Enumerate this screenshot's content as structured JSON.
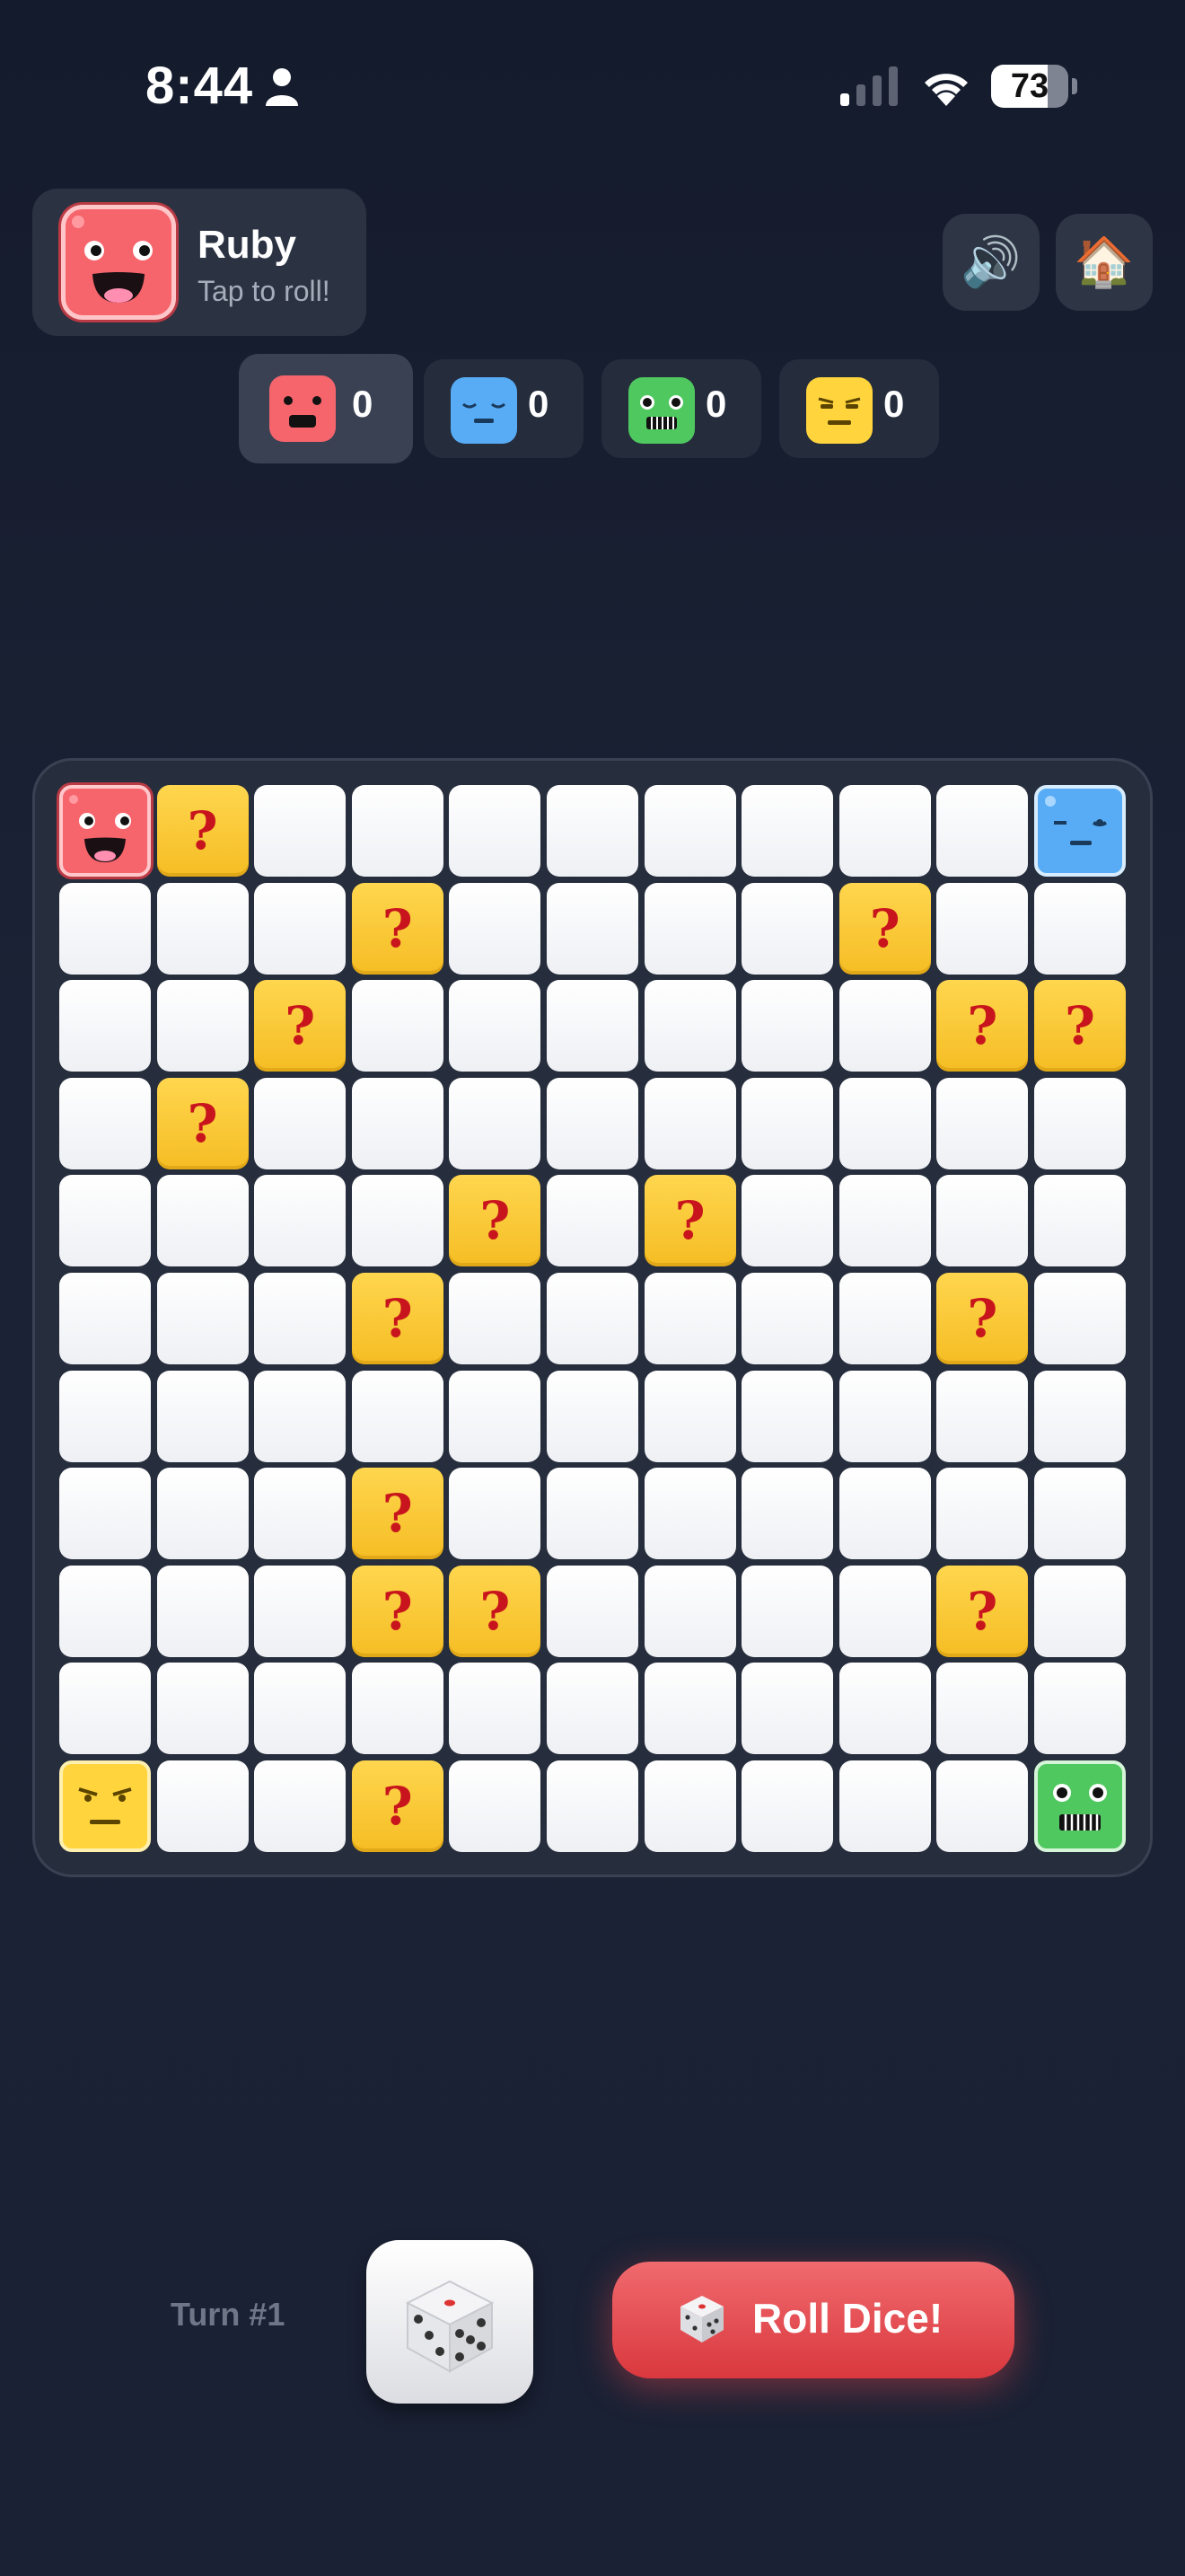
{
  "status_bar": {
    "time": "8:44",
    "battery": "73",
    "battery_level": 0.73
  },
  "player": {
    "name": "Ruby",
    "subtitle": "Tap to roll!"
  },
  "toolbar": {
    "sound_icon": "speaker-icon",
    "home_icon": "house-icon",
    "sound_glyph": "🔊",
    "home_glyph": "🏠"
  },
  "scores": [
    {
      "color": "red",
      "value": "0",
      "active": true
    },
    {
      "color": "blue",
      "value": "0",
      "active": false
    },
    {
      "color": "green",
      "value": "0",
      "active": false
    },
    {
      "color": "yellow",
      "value": "0",
      "active": false
    }
  ],
  "colors": {
    "red": "#f6646c",
    "blue": "#57acf5",
    "green": "#4fc85f",
    "yellow": "#ffd43d",
    "mystery": "#ffd64e",
    "roll_button": "#e0474c"
  },
  "board": {
    "rows": 11,
    "cols": 11,
    "mystery_symbol": "?",
    "mystery_cells": [
      [
        0,
        1
      ],
      [
        1,
        3
      ],
      [
        1,
        8
      ],
      [
        2,
        2
      ],
      [
        2,
        9
      ],
      [
        2,
        10
      ],
      [
        3,
        1
      ],
      [
        4,
        4
      ],
      [
        4,
        6
      ],
      [
        5,
        3
      ],
      [
        5,
        9
      ],
      [
        7,
        3
      ],
      [
        8,
        3
      ],
      [
        8,
        4
      ],
      [
        8,
        9
      ],
      [
        10,
        3
      ]
    ],
    "pieces": [
      {
        "color": "red",
        "row": 0,
        "col": 0
      },
      {
        "color": "blue",
        "row": 0,
        "col": 10
      },
      {
        "color": "yellow",
        "row": 10,
        "col": 0
      },
      {
        "color": "green",
        "row": 10,
        "col": 10
      }
    ]
  },
  "bottom": {
    "turn_label": "Turn #1",
    "roll_label": "Roll Dice!",
    "dice_icon": "dice-icon"
  }
}
